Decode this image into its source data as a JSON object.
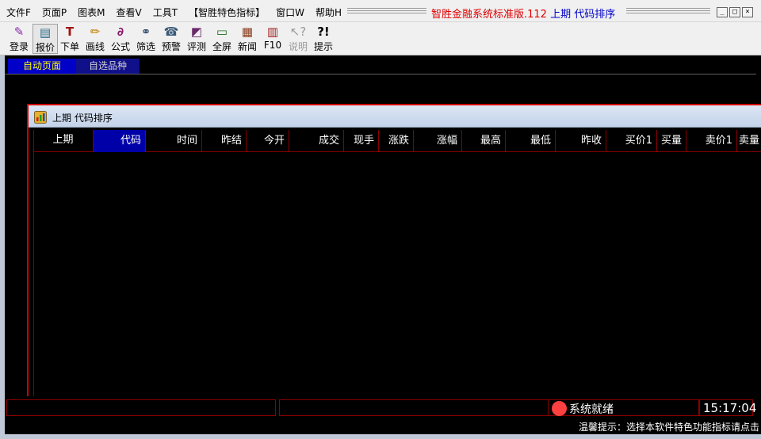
{
  "menu": {
    "items": [
      "文件F",
      "页面P",
      "图表M",
      "查看V",
      "工具T",
      "【智胜特色指标】",
      "窗口W",
      "帮助H"
    ],
    "title_main": "智胜金融系统标准版.112",
    "title_sub": "上期 代码排序",
    "window_buttons": [
      "_",
      "□",
      "×"
    ]
  },
  "toolbar": {
    "items": [
      {
        "label": "登录",
        "icon": "pencil-icon",
        "glyph": "✎"
      },
      {
        "label": "报价",
        "icon": "quote-icon",
        "glyph": "▤"
      },
      {
        "label": "下单",
        "icon": "order-icon",
        "glyph": "T"
      },
      {
        "label": "画线",
        "icon": "draw-line-icon",
        "glyph": "✏"
      },
      {
        "label": "公式",
        "icon": "formula-icon",
        "glyph": "∂"
      },
      {
        "label": "筛选",
        "icon": "binoculars-icon",
        "glyph": "⚭"
      },
      {
        "label": "预警",
        "icon": "alarm-icon",
        "glyph": "☎"
      },
      {
        "label": "评测",
        "icon": "evaluate-icon",
        "glyph": "◩"
      },
      {
        "label": "全屏",
        "icon": "fullscreen-icon",
        "glyph": "▭"
      },
      {
        "label": "新闻",
        "icon": "news-icon",
        "glyph": "▦"
      },
      {
        "label": "F10",
        "icon": "books-icon",
        "glyph": "▥"
      },
      {
        "label": "说明",
        "icon": "help-cursor-icon",
        "glyph": "↖?"
      },
      {
        "label": "提示",
        "icon": "tip-icon",
        "glyph": "?!"
      }
    ]
  },
  "tabs": [
    {
      "label": "自动页面"
    },
    {
      "label": "自选品种"
    }
  ],
  "child": {
    "title": "上期 代码排序",
    "columns": [
      "上期",
      "代码",
      "时间",
      "昨结",
      "今开",
      "成交",
      "现手",
      "涨跌",
      "涨幅",
      "最高",
      "最低",
      "昨收",
      "买价1",
      "买量",
      "卖价1",
      "卖量"
    ]
  },
  "status": {
    "ready": "系统就绪",
    "time": "15:17:04",
    "hint": "温馨提示：选择本软件特色功能指标请点击"
  },
  "colors": {
    "accent_red": "#e00000",
    "accent_blue": "#0000c8",
    "grid_line": "#8a0000"
  }
}
